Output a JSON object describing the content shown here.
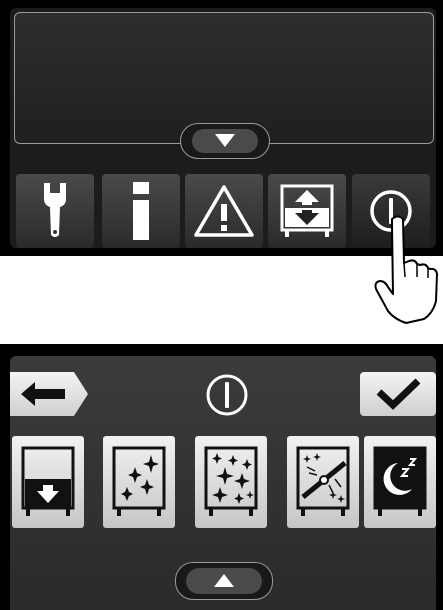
{
  "top_panel": {
    "display_text": "",
    "toolbar": [
      {
        "id": "settings",
        "icon": "wrench-icon"
      },
      {
        "id": "info",
        "icon": "info-icon"
      },
      {
        "id": "warning",
        "icon": "warning-icon"
      },
      {
        "id": "lift",
        "icon": "up-down-arrows-icon"
      },
      {
        "id": "power",
        "icon": "power-icon",
        "state": "pressed"
      }
    ],
    "expand_tab_icon": "chevron-down-icon"
  },
  "bottom_panel": {
    "header_icon": "power-icon",
    "back_icon": "arrow-left-icon",
    "confirm_icon": "checkmark-icon",
    "modes": [
      {
        "id": "down",
        "icon": "bed-down-icon"
      },
      {
        "id": "sparkle-light",
        "icon": "sparkle-few-icon"
      },
      {
        "id": "sparkle-heavy",
        "icon": "sparkle-many-icon"
      },
      {
        "id": "clean",
        "icon": "broom-clean-icon"
      },
      {
        "id": "sleep",
        "icon": "moon-sleep-icon"
      }
    ],
    "collapse_tab_icon": "chevron-up-icon"
  },
  "colors": {
    "frame": "#000000",
    "screen": "#1c1c1c",
    "button_light": "#e8e8e8"
  }
}
